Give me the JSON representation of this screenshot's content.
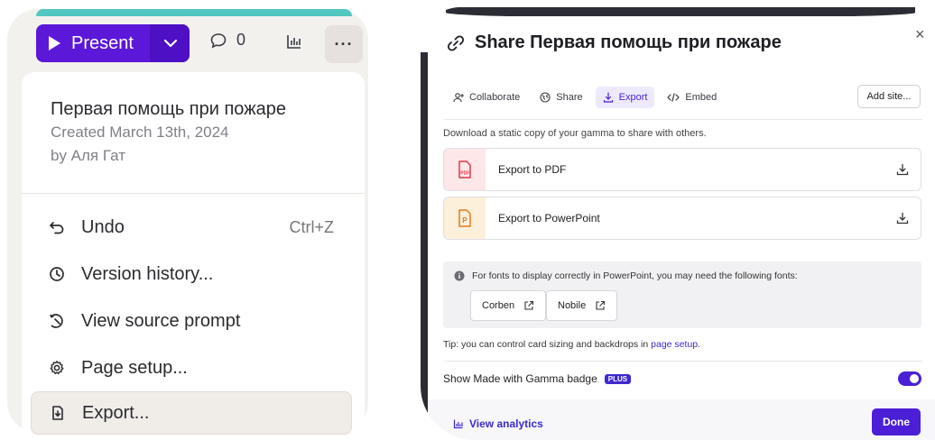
{
  "left": {
    "toolbar": {
      "present_label": "Present",
      "comment_count": "0",
      "more_label": "···",
      "icons": {
        "present": "play-icon",
        "dropdown": "chevron-down-icon",
        "comment": "comment-icon",
        "analytics": "analytics-icon",
        "more": "more-icon"
      }
    },
    "menu": {
      "doc_title": "Первая помощь при пожаре",
      "created": "Created March 13th, 2024",
      "author": "by Аля Гат",
      "items": [
        {
          "label": "Undo",
          "shortcut": "Ctrl+Z",
          "icon": "undo-icon"
        },
        {
          "label": "Version history...",
          "icon": "clock-icon"
        },
        {
          "label": "View source prompt",
          "icon": "history-wand-icon"
        },
        {
          "label": "Page setup...",
          "icon": "gear-icon"
        },
        {
          "label": "Export...",
          "icon": "export-file-icon",
          "active": true
        }
      ]
    }
  },
  "modal": {
    "title": "Share Первая помощь при пожаре",
    "close_label": "×",
    "tabs": [
      {
        "label": "Collaborate",
        "icon": "add-user-icon"
      },
      {
        "label": "Share",
        "icon": "globe-icon"
      },
      {
        "label": "Export",
        "icon": "download-icon",
        "active": true
      },
      {
        "label": "Embed",
        "icon": "code-icon"
      }
    ],
    "add_site_label": "Add site...",
    "description": "Download a static copy of your gamma to share with others.",
    "exports": [
      {
        "label": "Export to PDF",
        "icon": "pdf-file-icon",
        "tint": "#fde7e8",
        "icon_color": "#e0394b"
      },
      {
        "label": "Export to PowerPoint",
        "icon": "powerpoint-file-icon",
        "tint": "#fdf0da",
        "icon_color": "#e07a1f"
      }
    ],
    "fonts_note": "For fonts to display correctly in PowerPoint, you may need the following fonts:",
    "fonts": [
      "Corben",
      "Nobile"
    ],
    "tip_prefix": "Tip: you can control card sizing and backdrops in ",
    "tip_link": "page setup",
    "tip_suffix": ".",
    "badge_label": "Show Made with Gamma badge",
    "plus_label": "PLUS",
    "badge_enabled": true,
    "view_analytics_label": "View analytics",
    "done_label": "Done"
  },
  "colors": {
    "accent": "#4a1fd6",
    "present": "#5b18d8",
    "teal": "#52c7c0"
  }
}
